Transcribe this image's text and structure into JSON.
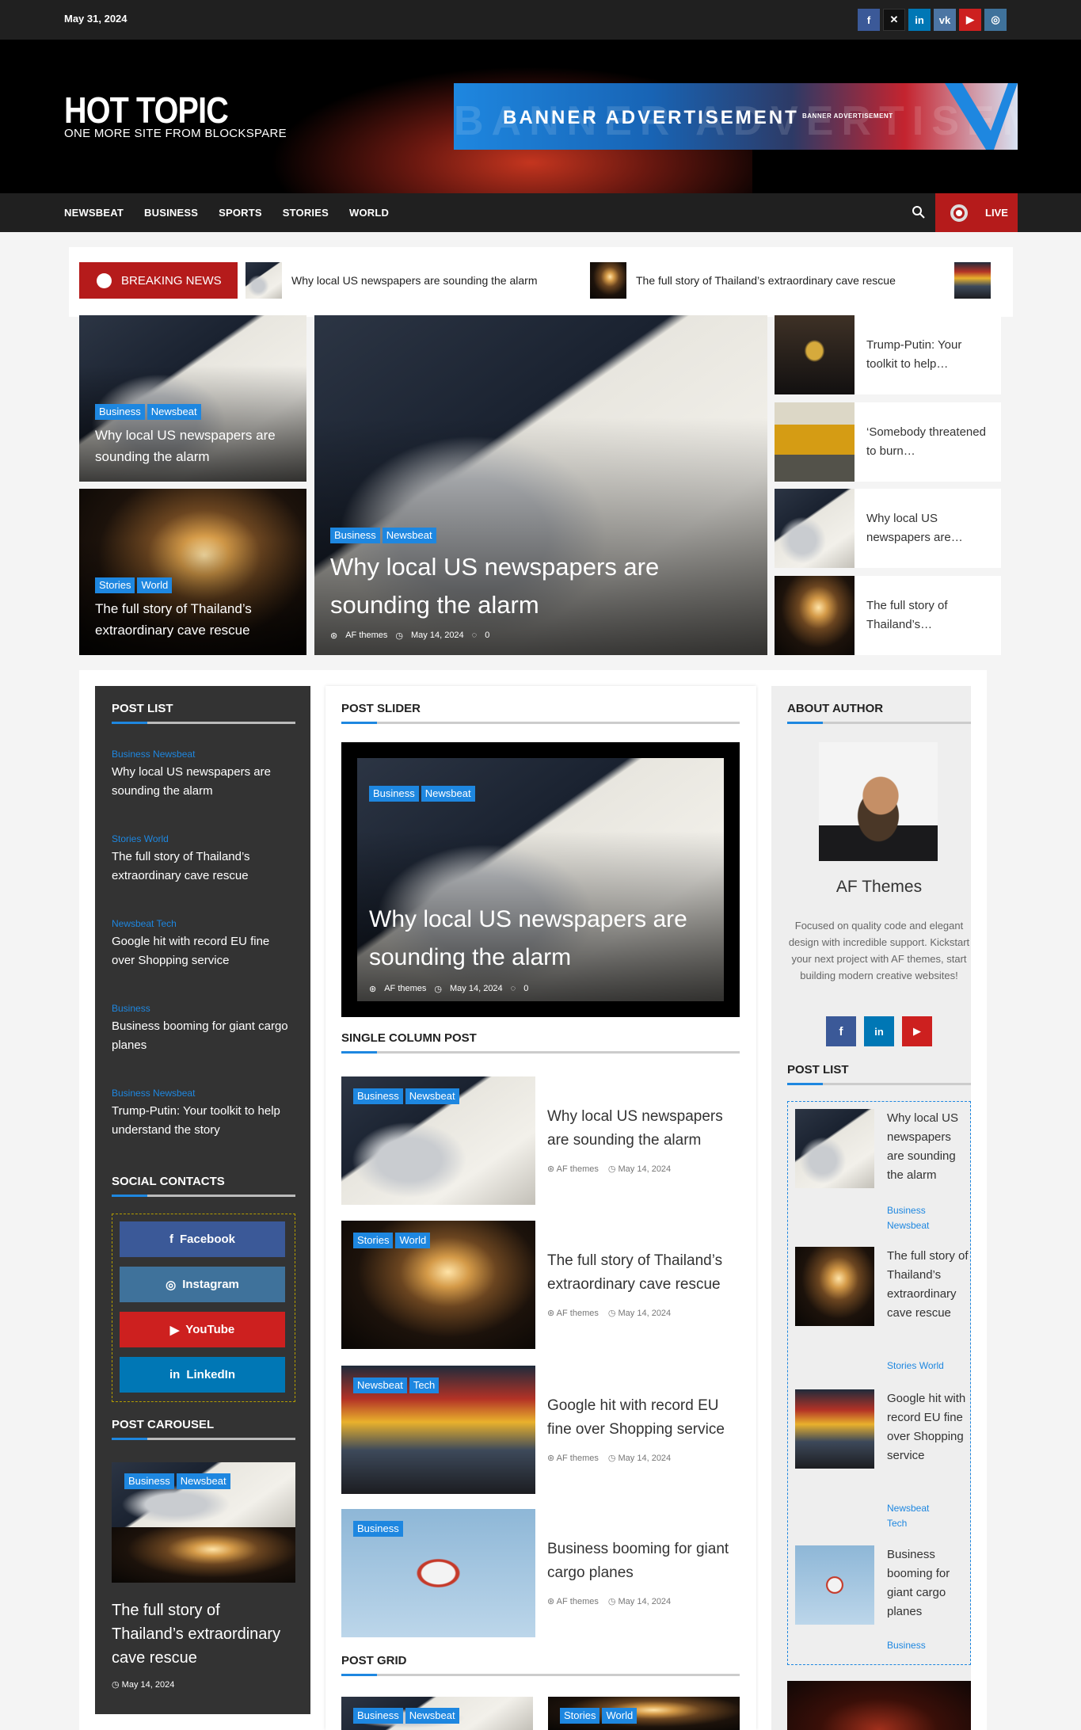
{
  "topbar": {
    "date": "May 31, 2024",
    "social": [
      {
        "icon": "facebook-icon",
        "glyph": "f",
        "color": "#3b5998"
      },
      {
        "icon": "x-icon",
        "glyph": "✕",
        "color": "#111111"
      },
      {
        "icon": "linkedin-icon",
        "glyph": "in",
        "color": "#0077b5"
      },
      {
        "icon": "vk-icon",
        "glyph": "vk",
        "color": "#4c75a3"
      },
      {
        "icon": "youtube-icon",
        "glyph": "▶",
        "color": "#cd201f"
      },
      {
        "icon": "instagram-icon",
        "glyph": "◎",
        "color": "#3f729b"
      }
    ]
  },
  "header": {
    "site_title": "HOT TOPIC",
    "tagline": "ONE MORE SITE FROM BLOCKSPARE",
    "banner_text": "BANNER ADVERTISEMENT",
    "banner_small_text": "BANNER ADVERTISEMENT"
  },
  "nav": {
    "items": [
      "NEWSBEAT",
      "BUSINESS",
      "SPORTS",
      "STORIES",
      "WORLD"
    ],
    "live_label": "LIVE"
  },
  "breaking": {
    "label": "BREAKING NEWS",
    "items": [
      "Why local US newspapers are sounding the alarm",
      "The full story of Thailand’s extraordinary cave rescue"
    ]
  },
  "hero": {
    "left_top": {
      "tags": [
        "Business",
        "Newsbeat"
      ],
      "title": "Why local US newspapers are sounding the alarm"
    },
    "left_bottom": {
      "tags": [
        "Stories",
        "World"
      ],
      "title": "The full story of Thailand’s extraordinary cave rescue"
    },
    "main": {
      "tags": [
        "Business",
        "Newsbeat"
      ],
      "title": "Why local US newspapers are sounding the alarm",
      "author": "AF themes",
      "date": "May 14, 2024",
      "comments": "0"
    },
    "side": [
      "Trump-Putin: Your toolkit to help…",
      "‘Somebody threatened to burn…",
      "Why local US newspapers are…",
      "The full story of Thailand’s…"
    ]
  },
  "post_list": {
    "title": "POST LIST",
    "items": [
      {
        "cats": [
          "Business",
          "Newsbeat"
        ],
        "title": "Why local US newspapers are sounding the alarm"
      },
      {
        "cats": [
          "Stories",
          "World"
        ],
        "title": "The full story of Thailand’s extraordinary cave rescue"
      },
      {
        "cats": [
          "Newsbeat",
          "Tech"
        ],
        "title": "Google hit with record EU fine over Shopping service"
      },
      {
        "cats": [
          "Business"
        ],
        "title": "Business booming for giant cargo planes"
      },
      {
        "cats": [
          "Business",
          "Newsbeat"
        ],
        "title": "Trump-Putin: Your toolkit to help understand the story"
      }
    ]
  },
  "social_contacts": {
    "title": "SOCIAL CONTACTS",
    "buttons": [
      {
        "label": "Facebook",
        "icon": "facebook-icon",
        "glyph": "f",
        "color": "#3b5998"
      },
      {
        "label": "Instagram",
        "icon": "instagram-icon",
        "glyph": "◎",
        "color": "#3f729b"
      },
      {
        "label": "YouTube",
        "icon": "youtube-icon",
        "glyph": "▶",
        "color": "#cd201f"
      },
      {
        "label": "LinkedIn",
        "icon": "linkedin-icon",
        "glyph": "in",
        "color": "#0077b5"
      }
    ]
  },
  "post_carousel": {
    "title": "POST CAROUSEL",
    "tags": [
      "Business",
      "Newsbeat"
    ],
    "post_title": "The full story of Thailand’s extraordinary cave rescue",
    "date": "May 14, 2024"
  },
  "post_slider": {
    "title": "POST SLIDER",
    "tags": [
      "Business",
      "Newsbeat"
    ],
    "post_title": "Why local US newspapers are sounding the alarm",
    "author": "AF themes",
    "date": "May 14, 2024",
    "comments": "0"
  },
  "single_column": {
    "title": "SINGLE COLUMN POST",
    "items": [
      {
        "tags": [
          "Business",
          "Newsbeat"
        ],
        "title": "Why local US newspapers are sounding the alarm",
        "author": "AF themes",
        "date": "May 14, 2024"
      },
      {
        "tags": [
          "Stories",
          "World"
        ],
        "title": "The full story of Thailand’s extraordinary cave rescue",
        "author": "AF themes",
        "date": "May 14, 2024"
      },
      {
        "tags": [
          "Newsbeat",
          "Tech"
        ],
        "title": "Google hit with record EU fine over Shopping service",
        "author": "AF themes",
        "date": "May 14, 2024"
      },
      {
        "tags": [
          "Business"
        ],
        "title": "Business booming for giant cargo planes",
        "author": "AF themes",
        "date": "May 14, 2024"
      }
    ]
  },
  "post_grid": {
    "title": "POST GRID",
    "items": [
      {
        "tags": [
          "Business",
          "Newsbeat"
        ]
      },
      {
        "tags": [
          "Stories",
          "World"
        ]
      }
    ]
  },
  "about_author": {
    "title": "ABOUT AUTHOR",
    "name": "AF Themes",
    "bio": "Focused on quality code and elegant design with incredible support. Kickstart your next project with AF themes, start building modern creative websites!",
    "social": [
      {
        "icon": "facebook-icon",
        "glyph": "f"
      },
      {
        "icon": "linkedin-icon",
        "glyph": "in"
      },
      {
        "icon": "youtube-icon",
        "glyph": "▶"
      }
    ]
  },
  "right_post_list": {
    "title": "POST LIST",
    "items": [
      {
        "title": "Why local US newspapers are sounding the alarm",
        "cats": [
          "Business",
          "Newsbeat"
        ]
      },
      {
        "title": "The full story of Thailand’s extraordinary cave rescue",
        "cats": [
          "Stories",
          "World"
        ]
      },
      {
        "title": "Google hit with record EU fine over Shopping service",
        "cats": [
          "Newsbeat",
          "Tech"
        ]
      },
      {
        "title": "Business booming for giant cargo planes",
        "cats": [
          "Business"
        ]
      }
    ]
  },
  "colors": {
    "accent": "#1e87e0",
    "live": "#b51b1b",
    "dark": "#202020"
  }
}
